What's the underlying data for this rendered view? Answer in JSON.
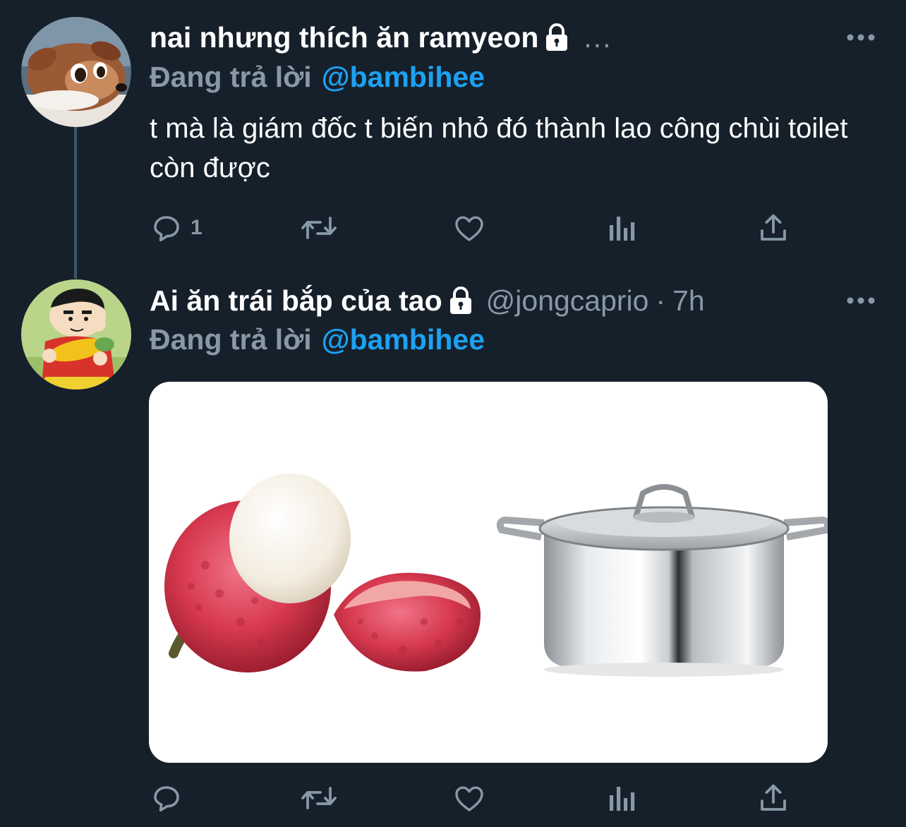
{
  "tweets": [
    {
      "display_name": "nai nhưng thích ăn ramyeon",
      "truncated": "...",
      "replying_label": "Đang trả lời",
      "replying_to": "@bambihee",
      "text": "t mà là giám đốc t biến nhỏ đó thành lao công chùi toilet còn được",
      "reply_count": "1"
    },
    {
      "display_name": "Ai ăn trái bắp của tao",
      "handle": "@jongcaprio",
      "separator": "·",
      "time": "7h",
      "replying_label": "Đang trả lời",
      "replying_to": "@bambihee",
      "reply_count": ""
    }
  ],
  "icons": {
    "protected": "lock-icon",
    "more": "more-icon",
    "reply": "reply-icon",
    "retweet": "retweet-icon",
    "like": "heart-icon",
    "analytics": "analytics-icon",
    "share": "share-icon"
  },
  "colors": {
    "background": "#15202b",
    "secondary_text": "#8899a6",
    "accent": "#1da1f2",
    "thread_line": "#3d5466"
  }
}
